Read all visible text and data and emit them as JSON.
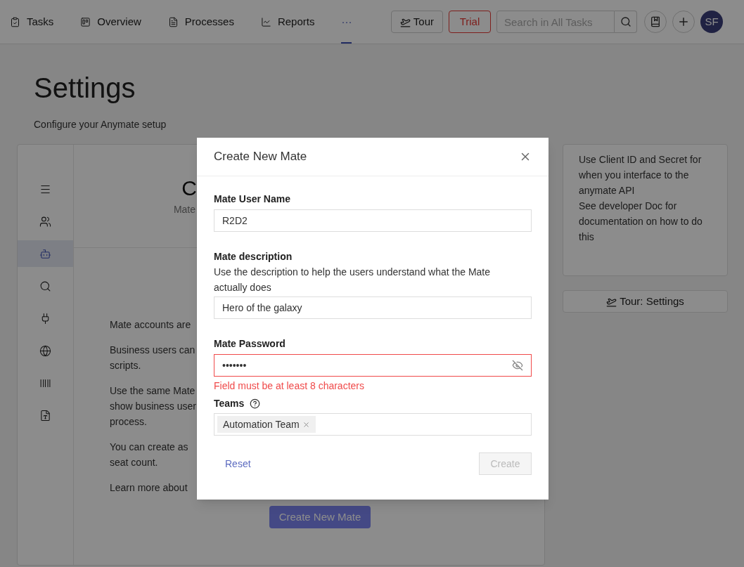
{
  "nav": {
    "tabs": [
      {
        "label": "Tasks",
        "selected": false
      },
      {
        "label": "Overview",
        "selected": false
      },
      {
        "label": "Processes",
        "selected": false
      },
      {
        "label": "Reports",
        "selected": false
      },
      {
        "label": "···",
        "selected": true
      }
    ],
    "tour_button": "Tour",
    "trial_button": "Trial",
    "search": {
      "placeholder": "Search in All Tasks"
    },
    "avatar": "SF"
  },
  "page": {
    "title": "Settings",
    "subtitle": "Configure your Anymate setup"
  },
  "sidebar": {
    "items": [
      {
        "selected": false
      },
      {
        "selected": false
      },
      {
        "selected": true
      },
      {
        "selected": false
      },
      {
        "selected": false
      },
      {
        "selected": false
      },
      {
        "selected": false
      },
      {
        "selected": false
      }
    ]
  },
  "content": {
    "heading": "C",
    "subheading": "Mate",
    "paragraphs": [
      [
        "Mate accounts are"
      ],
      [
        "Business users can",
        "scripts."
      ],
      [
        "Use the same Mate",
        "show business user",
        "process."
      ],
      [
        "You can create as",
        "seat count."
      ],
      [
        "Learn more about"
      ]
    ],
    "create_button": "Create New Mate"
  },
  "info": {
    "lines": [
      "Use Client ID and Secret for when you interface to the anymate API",
      "See developer Doc for documentation on how to do this"
    ],
    "tour_button": "Tour: Settings"
  },
  "modal": {
    "title": "Create New Mate",
    "username": {
      "label": "Mate User Name",
      "value": "R2D2"
    },
    "description": {
      "label": "Mate description",
      "help": "Use the description to help the users understand what the Mate actually does",
      "value": "Hero of the galaxy"
    },
    "password": {
      "label": "Mate Password",
      "value": "•••••••",
      "error": "Field must be at least 8 characters"
    },
    "teams": {
      "label": "Teams",
      "tags": [
        "Automation Team"
      ]
    },
    "reset_button": "Reset",
    "create_button": {
      "label": "Create",
      "disabled": true
    }
  }
}
